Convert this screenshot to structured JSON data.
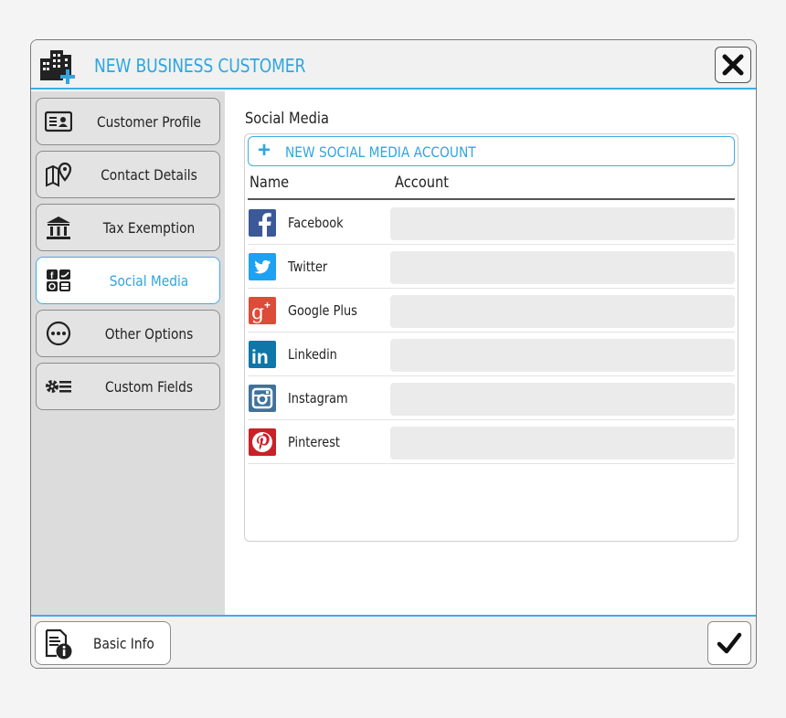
{
  "dialog": {
    "title": "NEW BUSINESS CUSTOMER"
  },
  "sidebar": {
    "items": [
      {
        "label": "Customer Profile",
        "icon": "id-card-icon"
      },
      {
        "label": "Contact Details",
        "icon": "map-pin-icon"
      },
      {
        "label": "Tax Exemption",
        "icon": "bank-icon"
      },
      {
        "label": "Social Media",
        "icon": "social-media-icon",
        "active": true
      },
      {
        "label": "Other Options",
        "icon": "more-options-icon"
      },
      {
        "label": "Custom Fields",
        "icon": "gear-list-icon"
      }
    ]
  },
  "main": {
    "section_title": "Social Media",
    "new_account_label": "NEW SOCIAL MEDIA ACCOUNT",
    "columns": {
      "name": "Name",
      "account": "Account"
    },
    "rows": [
      {
        "name": "Facebook",
        "icon": "facebook-icon",
        "color": "#3b5998",
        "account": ""
      },
      {
        "name": "Twitter",
        "icon": "twitter-icon",
        "color": "#1da1f2",
        "account": ""
      },
      {
        "name": "Google Plus",
        "icon": "google-plus-icon",
        "color": "#dd4b39",
        "account": ""
      },
      {
        "name": "Linkedin",
        "icon": "linkedin-icon",
        "color": "#0e76a8",
        "account": ""
      },
      {
        "name": "Instagram",
        "icon": "instagram-icon",
        "color": "#3f729b",
        "account": ""
      },
      {
        "name": "Pinterest",
        "icon": "pinterest-icon",
        "color": "#cb2027",
        "account": ""
      }
    ]
  },
  "footer": {
    "basic_info_label": "Basic Info"
  },
  "colors": {
    "accent": "#3daee0",
    "sidebar_bg": "#dcdcdc"
  }
}
